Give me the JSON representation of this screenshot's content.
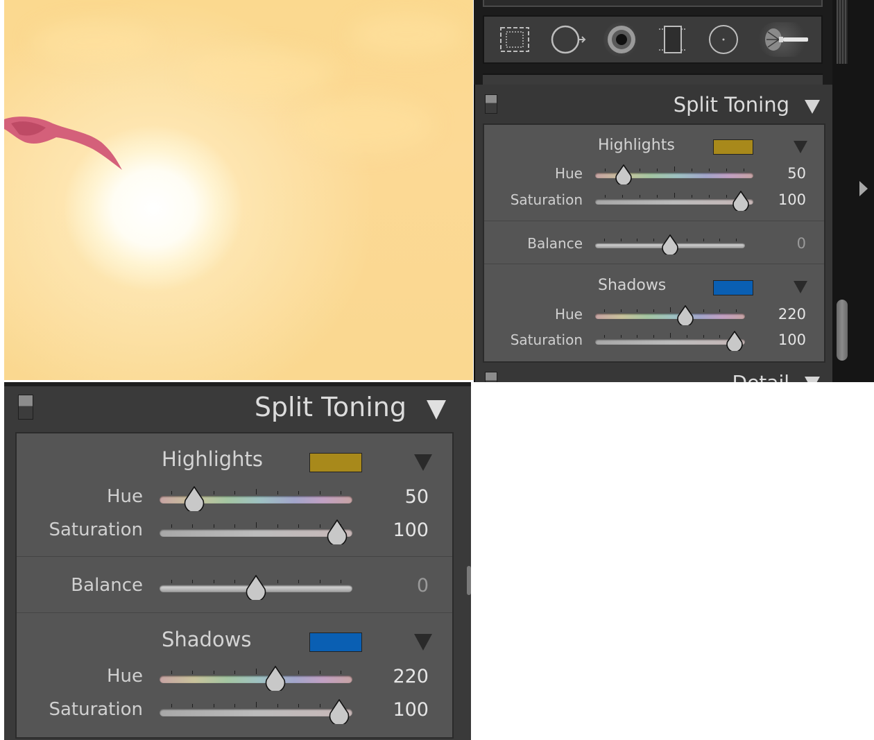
{
  "toolbar": {
    "tools": [
      {
        "icon": "crop-overlay-icon"
      },
      {
        "icon": "spot-removal-icon"
      },
      {
        "icon": "red-eye-icon"
      },
      {
        "icon": "graduated-filter-icon"
      },
      {
        "icon": "radial-filter-icon"
      },
      {
        "icon": "adjustment-brush-icon"
      }
    ]
  },
  "panel": {
    "title": "Split Toning",
    "next_panel_title": "Detail",
    "highlights": {
      "label": "Highlights",
      "swatch_color": "#a8891b",
      "hue_label": "Hue",
      "hue_value": "50",
      "hue_position": 0.18,
      "saturation_label": "Saturation",
      "saturation_value": "100",
      "saturation_position": 0.92
    },
    "balance": {
      "label": "Balance",
      "value": "0",
      "position": 0.5
    },
    "shadows": {
      "label": "Shadows",
      "swatch_color": "#0a5fb3",
      "hue_label": "Hue",
      "hue_value": "220",
      "hue_position": 0.6,
      "saturation_label": "Saturation",
      "saturation_value": "100",
      "saturation_position": 0.93
    }
  },
  "colors": {
    "panel_bg": "#3a3a3a",
    "section_bg": "#555555",
    "sky": "#fbd98f",
    "bird": "#d4607a"
  }
}
